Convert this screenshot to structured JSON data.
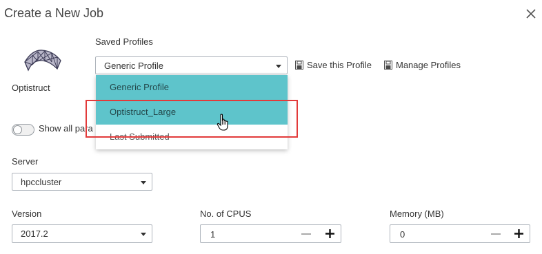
{
  "dialog": {
    "title": "Create a New Job",
    "close_icon": "close-icon"
  },
  "application": {
    "name": "Optistruct",
    "icon": "optistruct-truss-icon"
  },
  "profiles": {
    "label": "Saved Profiles",
    "selected": "Generic Profile",
    "options": [
      "Generic Profile",
      "Optistruct_Large",
      "Last Submitted"
    ],
    "hovered": "Optistruct_Large",
    "save_label": "Save this Profile",
    "manage_label": "Manage Profiles",
    "highlight_color": "#e23a3a",
    "accent_color": "#5ec4cb"
  },
  "parameters_toggle": {
    "label": "Show all para",
    "state": "off"
  },
  "server": {
    "label": "Server",
    "value": "hpccluster"
  },
  "version": {
    "label": "Version",
    "value": "2017.2"
  },
  "cpus": {
    "label": "No. of CPUS",
    "value": "1"
  },
  "memory": {
    "label": "Memory (MB)",
    "value": "0"
  }
}
